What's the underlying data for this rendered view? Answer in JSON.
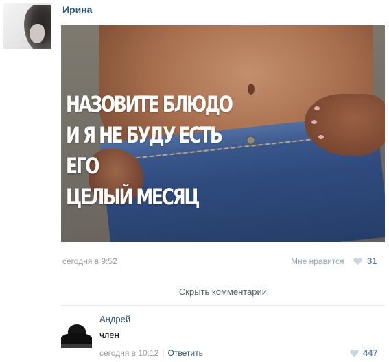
{
  "post": {
    "author": "Ирина",
    "image_caption": "НАЗОВИТЕ БЛЮДО\nИ Я НЕ БУДУ ЕСТЬ ЕГО\nЦЕЛЫЙ МЕСЯЦ",
    "date": "сегодня в 9:52",
    "like_label": "Мне нравится",
    "like_count": "31"
  },
  "comments_toggle": "Скрыть комментарии",
  "comment": {
    "author": "Андрей",
    "text": "член",
    "date": "сегодня в 10:12",
    "separator": "|",
    "reply_label": "Ответить",
    "like_count": "447"
  },
  "colors": {
    "link": "#2b587a",
    "like_count": "#5e80a7",
    "heart": "#c9d5e1",
    "muted": "#9a9a9a"
  },
  "icons": {
    "like": "heart-icon"
  }
}
